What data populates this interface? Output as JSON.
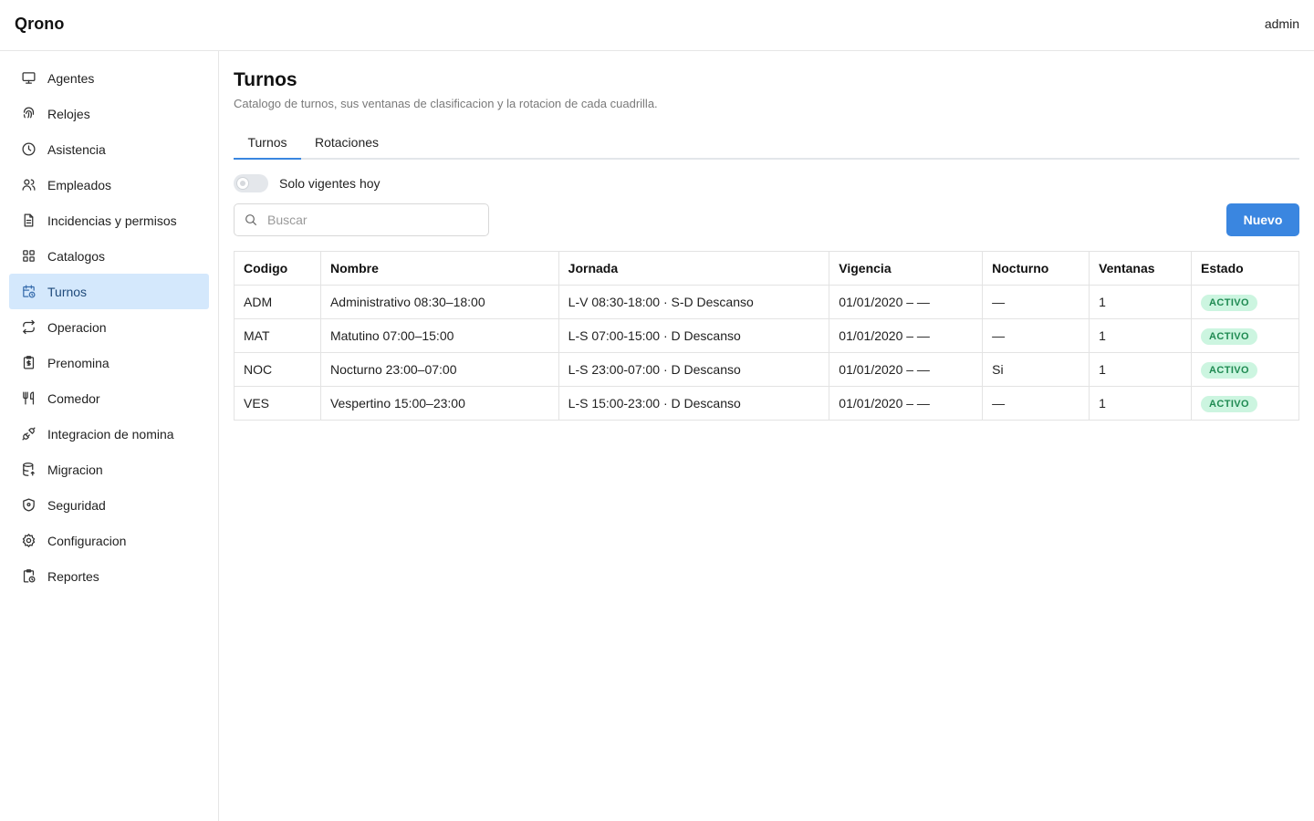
{
  "header": {
    "brand": "Qrono",
    "user": "admin"
  },
  "sidebar": {
    "items": [
      {
        "label": "Agentes",
        "icon": "monitor-icon",
        "active": false
      },
      {
        "label": "Relojes",
        "icon": "fingerprint-icon",
        "active": false
      },
      {
        "label": "Asistencia",
        "icon": "clock-icon",
        "active": false
      },
      {
        "label": "Empleados",
        "icon": "users-icon",
        "active": false
      },
      {
        "label": "Incidencias y permisos",
        "icon": "document-icon",
        "active": false
      },
      {
        "label": "Catalogos",
        "icon": "grid-icon",
        "active": false
      },
      {
        "label": "Turnos",
        "icon": "calendar-clock-icon",
        "active": true
      },
      {
        "label": "Operacion",
        "icon": "repeat-icon",
        "active": false
      },
      {
        "label": "Prenomina",
        "icon": "clipboard-icon",
        "active": false
      },
      {
        "label": "Comedor",
        "icon": "utensils-icon",
        "active": false
      },
      {
        "label": "Integracion de nomina",
        "icon": "plug-icon",
        "active": false
      },
      {
        "label": "Migracion",
        "icon": "database-icon",
        "active": false
      },
      {
        "label": "Seguridad",
        "icon": "shield-icon",
        "active": false
      },
      {
        "label": "Configuracion",
        "icon": "gear-icon",
        "active": false
      },
      {
        "label": "Reportes",
        "icon": "clipboard-clock-icon",
        "active": false
      }
    ]
  },
  "main": {
    "title": "Turnos",
    "subtitle": "Catalogo de turnos, sus ventanas de clasificacion y la rotacion de cada cuadrilla.",
    "tabs": [
      {
        "label": "Turnos",
        "active": true
      },
      {
        "label": "Rotaciones",
        "active": false
      }
    ],
    "toggle": {
      "label": "Solo vigentes hoy",
      "on": false
    },
    "search": {
      "placeholder": "Buscar",
      "value": ""
    },
    "new_button": "Nuevo",
    "table": {
      "columns": [
        "Codigo",
        "Nombre",
        "Jornada",
        "Vigencia",
        "Nocturno",
        "Ventanas",
        "Estado"
      ],
      "rows": [
        {
          "codigo": "ADM",
          "nombre": "Administrativo 08:30–18:00",
          "jornada": "L-V 08:30-18:00 · S-D Descanso",
          "vigencia": "01/01/2020 – —",
          "nocturno": "—",
          "ventanas": "1",
          "estado": "ACTIVO"
        },
        {
          "codigo": "MAT",
          "nombre": "Matutino 07:00–15:00",
          "jornada": "L-S 07:00-15:00 · D Descanso",
          "vigencia": "01/01/2020 – —",
          "nocturno": "—",
          "ventanas": "1",
          "estado": "ACTIVO"
        },
        {
          "codigo": "NOC",
          "nombre": "Nocturno 23:00–07:00",
          "jornada": "L-S 23:00-07:00 · D Descanso",
          "vigencia": "01/01/2020 – —",
          "nocturno": "Si",
          "ventanas": "1",
          "estado": "ACTIVO"
        },
        {
          "codigo": "VES",
          "nombre": "Vespertino 15:00–23:00",
          "jornada": "L-S 15:00-23:00 · D Descanso",
          "vigencia": "01/01/2020 – —",
          "nocturno": "—",
          "ventanas": "1",
          "estado": "ACTIVO"
        }
      ]
    }
  },
  "colors": {
    "accent": "#3a86e0",
    "active_nav_bg": "#d4e8fc",
    "badge_bg": "#ccf5e0",
    "badge_text": "#1f8a52"
  }
}
